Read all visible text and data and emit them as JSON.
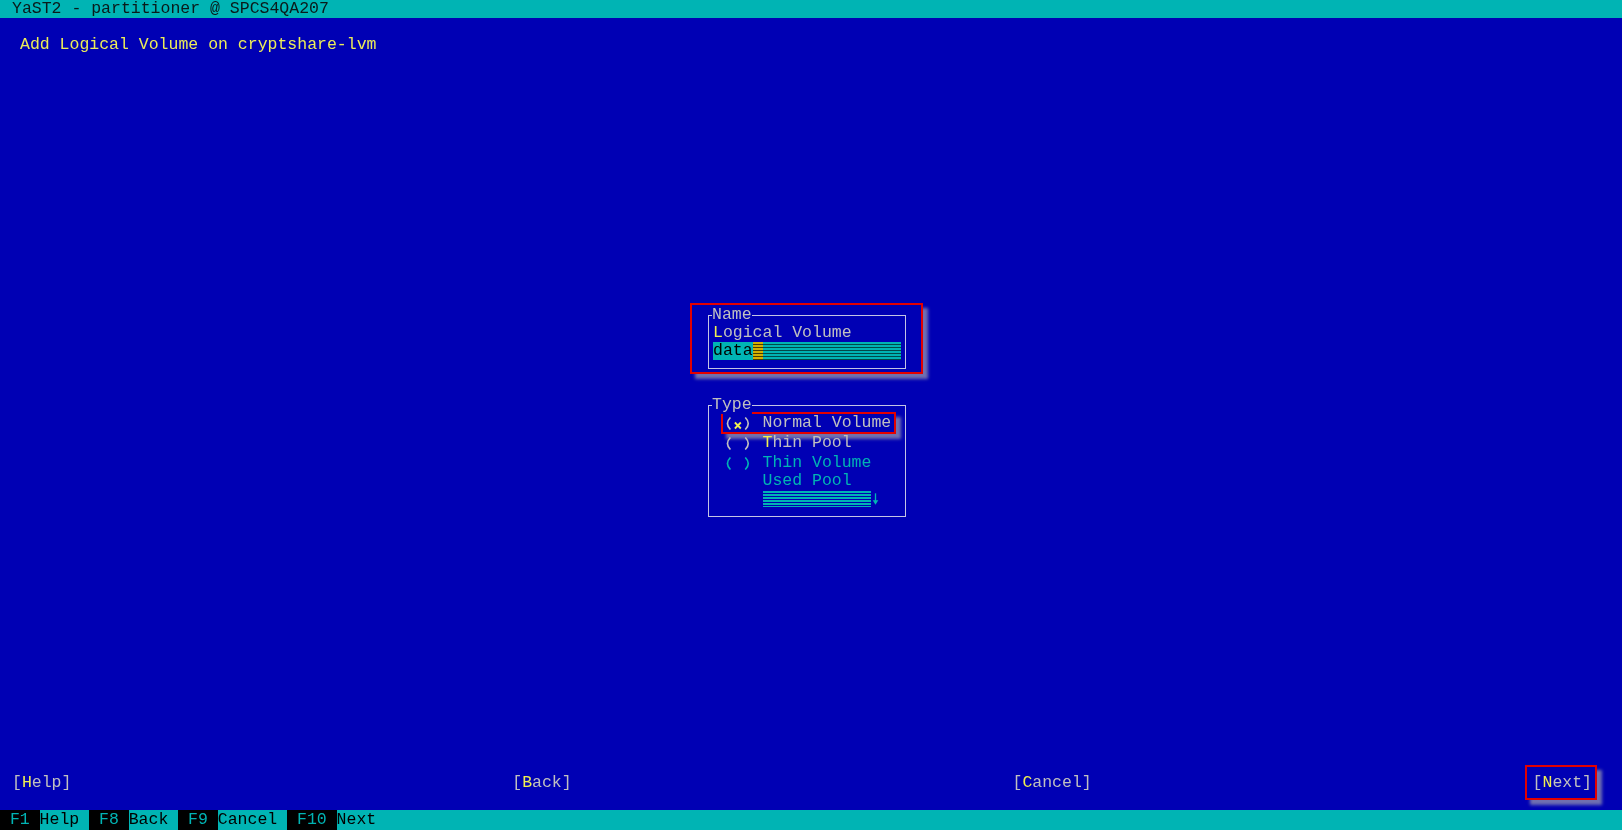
{
  "window": {
    "title": "YaST2 - partitioner @ SPCS4QA207"
  },
  "heading": "Add Logical Volume on cryptshare-lvm",
  "name_group": {
    "title": "Name",
    "label": "**L**ogical Volume",
    "value": "data",
    "focused": true,
    "highlighted": true
  },
  "type_group": {
    "title": "Type",
    "options": [
      {
        "label": "Normal Volume",
        "selected": true,
        "disabled": false,
        "highlighted": true
      },
      {
        "label": "**T**hin Pool",
        "selected": false,
        "disabled": false,
        "highlighted": false
      },
      {
        "label": "Thin Volume",
        "selected": false,
        "disabled": true,
        "highlighted": false
      }
    ],
    "pool": {
      "label": "Used Pool",
      "disabled": true
    }
  },
  "buttons": [
    {
      "label": "[**H**elp]",
      "highlighted": false
    },
    {
      "label": "[**B**ack]",
      "highlighted": false
    },
    {
      "label": "[**C**ancel]",
      "highlighted": false
    },
    {
      "label": "[**N**ext]",
      "highlighted": true
    }
  ],
  "function_keys": [
    {
      "key": "F1",
      "label": "Help"
    },
    {
      "key": "F8",
      "label": "Back"
    },
    {
      "key": "F9",
      "label": "Cancel"
    },
    {
      "key": "F10",
      "label": "Next"
    }
  ]
}
